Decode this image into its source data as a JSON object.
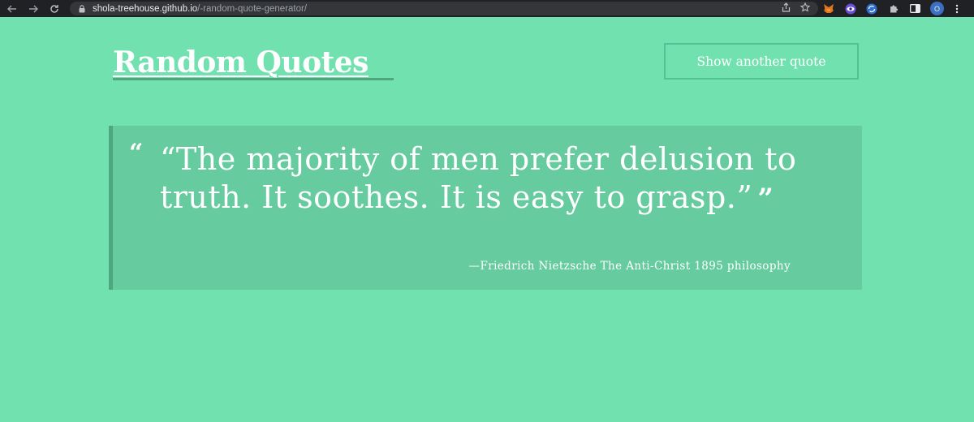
{
  "browser": {
    "url_host": "shola-treehouse.github.io",
    "url_path": "/-random-quote-generator/",
    "profile_initial": "O",
    "nav_icons": [
      "back-arrow-icon",
      "forward-arrow-icon",
      "reload-icon"
    ],
    "toolbar_icons": [
      "share-icon",
      "bookmark-star-icon",
      "metamask-extension-icon",
      "eye-extension-icon",
      "sync-extension-icon",
      "extensions-puzzle-icon",
      "side-panel-icon",
      "menu-kebab-icon"
    ]
  },
  "header": {
    "title": "Random Quotes",
    "show_button_label": "Show another quote"
  },
  "quote": {
    "open_mark": "“",
    "text": "“The majority of men prefer delusion to truth. It soothes. It is easy to grasp.”",
    "close_mark": "”",
    "source": "—Friedrich Nietzsche The Anti-Christ 1895 philosophy"
  },
  "colors": {
    "background": "#72e1b0",
    "quote_box": "#66cb9e",
    "accent_border": "#4fa77e",
    "button_border": "#4fc393",
    "text": "#ffffff"
  }
}
